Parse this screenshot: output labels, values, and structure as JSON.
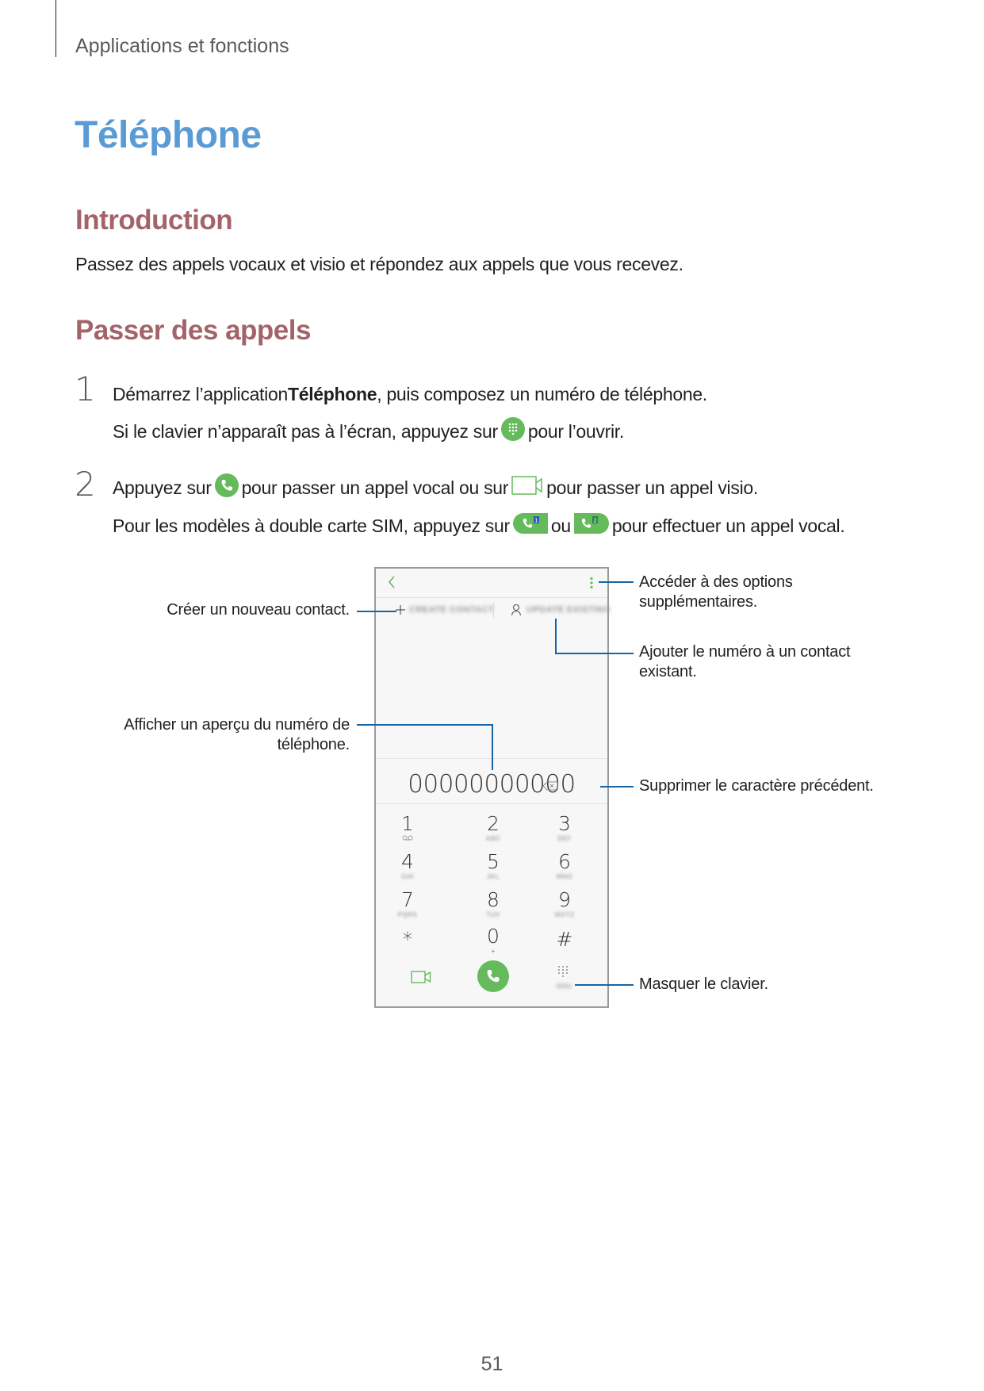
{
  "header": {
    "running_title": "Applications et fonctions"
  },
  "chapter": {
    "title": "Téléphone"
  },
  "sections": [
    {
      "title": "Introduction",
      "body": "Passez des appels vocaux et visio et répondez aux appels que vous recevez."
    },
    {
      "title": "Passer des appels",
      "steps": [
        {
          "number": "1",
          "line1_pre": "Démarrez l’application ",
          "line1_bold": "Téléphone",
          "line1_post": ", puis composez un numéro de téléphone.",
          "line2_pre": "Si le clavier n’apparaît pas à l’écran, appuyez sur",
          "line2_icon": "keypad-icon",
          "line2_post": "pour l’ouvrir."
        },
        {
          "number": "2",
          "line1_pre": "Appuyez sur",
          "line1_icon1": "voice-call-icon",
          "line1_mid": "pour passer un appel vocal ou sur",
          "line1_icon2": "video-call-icon",
          "line1_post": "pour passer un appel visio.",
          "line2_pre": "Pour les modèles à double carte SIM, appuyez sur",
          "line2_icon1": "sim1-call-icon",
          "line2_mid": "ou",
          "line2_icon2": "sim2-call-icon",
          "line2_post": "pour effectuer un appel vocal."
        }
      ]
    }
  ],
  "phone": {
    "create_contact": "CREATE CONTACT",
    "update_existing": "UPDATE EXISTING",
    "number": "00000000000",
    "keys": [
      {
        "digit": "1",
        "sub": "voicemail"
      },
      {
        "digit": "2",
        "sub": "ABC"
      },
      {
        "digit": "3",
        "sub": "DEF"
      },
      {
        "digit": "4",
        "sub": "GHI"
      },
      {
        "digit": "5",
        "sub": "JKL"
      },
      {
        "digit": "6",
        "sub": "MNO"
      },
      {
        "digit": "7",
        "sub": "PQRS"
      },
      {
        "digit": "8",
        "sub": "TUV"
      },
      {
        "digit": "9",
        "sub": "WXYZ"
      },
      {
        "digit": "*",
        "sub": ""
      },
      {
        "digit": "0",
        "sub": "+"
      },
      {
        "digit": "#",
        "sub": ""
      }
    ],
    "hide_label": "Hide",
    "accent_color": "#65bb5b"
  },
  "annotations": {
    "more_options": [
      "Accéder à des options",
      "supplémentaires."
    ],
    "create_contact": [
      "Créer un nouveau contact."
    ],
    "update_existing": [
      "Ajouter le numéro à un contact",
      "existant."
    ],
    "preview_number": [
      "Afficher un aperçu du numéro de",
      "téléphone."
    ],
    "delete_char": [
      "Supprimer le caractère précédent."
    ],
    "hide_keypad": [
      "Masquer le clavier."
    ]
  },
  "page_number": "51"
}
